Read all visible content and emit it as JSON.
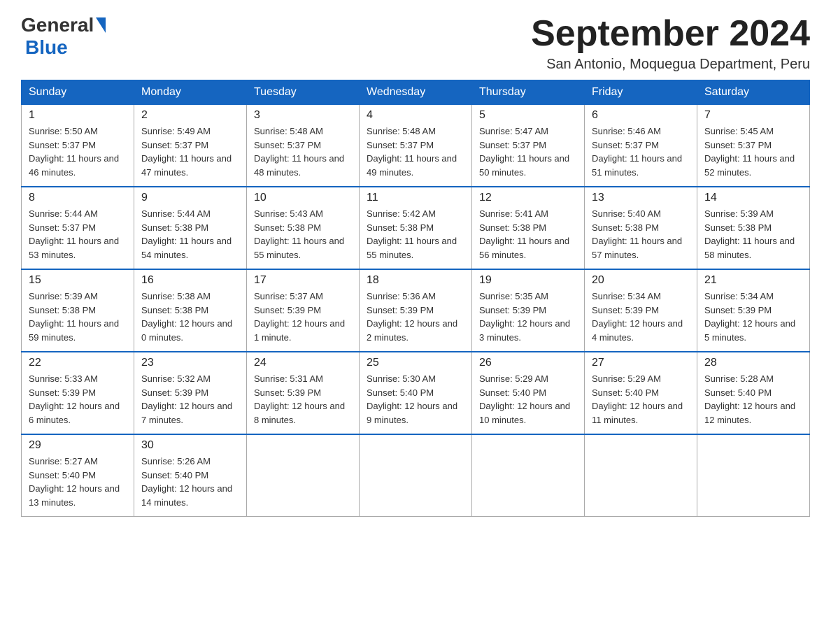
{
  "logo": {
    "general": "General",
    "blue": "Blue"
  },
  "header": {
    "month_year": "September 2024",
    "location": "San Antonio, Moquegua Department, Peru"
  },
  "weekdays": [
    "Sunday",
    "Monday",
    "Tuesday",
    "Wednesday",
    "Thursday",
    "Friday",
    "Saturday"
  ],
  "weeks": [
    [
      {
        "day": "1",
        "sunrise": "5:50 AM",
        "sunset": "5:37 PM",
        "daylight": "11 hours and 46 minutes."
      },
      {
        "day": "2",
        "sunrise": "5:49 AM",
        "sunset": "5:37 PM",
        "daylight": "11 hours and 47 minutes."
      },
      {
        "day": "3",
        "sunrise": "5:48 AM",
        "sunset": "5:37 PM",
        "daylight": "11 hours and 48 minutes."
      },
      {
        "day": "4",
        "sunrise": "5:48 AM",
        "sunset": "5:37 PM",
        "daylight": "11 hours and 49 minutes."
      },
      {
        "day": "5",
        "sunrise": "5:47 AM",
        "sunset": "5:37 PM",
        "daylight": "11 hours and 50 minutes."
      },
      {
        "day": "6",
        "sunrise": "5:46 AM",
        "sunset": "5:37 PM",
        "daylight": "11 hours and 51 minutes."
      },
      {
        "day": "7",
        "sunrise": "5:45 AM",
        "sunset": "5:37 PM",
        "daylight": "11 hours and 52 minutes."
      }
    ],
    [
      {
        "day": "8",
        "sunrise": "5:44 AM",
        "sunset": "5:37 PM",
        "daylight": "11 hours and 53 minutes."
      },
      {
        "day": "9",
        "sunrise": "5:44 AM",
        "sunset": "5:38 PM",
        "daylight": "11 hours and 54 minutes."
      },
      {
        "day": "10",
        "sunrise": "5:43 AM",
        "sunset": "5:38 PM",
        "daylight": "11 hours and 55 minutes."
      },
      {
        "day": "11",
        "sunrise": "5:42 AM",
        "sunset": "5:38 PM",
        "daylight": "11 hours and 55 minutes."
      },
      {
        "day": "12",
        "sunrise": "5:41 AM",
        "sunset": "5:38 PM",
        "daylight": "11 hours and 56 minutes."
      },
      {
        "day": "13",
        "sunrise": "5:40 AM",
        "sunset": "5:38 PM",
        "daylight": "11 hours and 57 minutes."
      },
      {
        "day": "14",
        "sunrise": "5:39 AM",
        "sunset": "5:38 PM",
        "daylight": "11 hours and 58 minutes."
      }
    ],
    [
      {
        "day": "15",
        "sunrise": "5:39 AM",
        "sunset": "5:38 PM",
        "daylight": "11 hours and 59 minutes."
      },
      {
        "day": "16",
        "sunrise": "5:38 AM",
        "sunset": "5:38 PM",
        "daylight": "12 hours and 0 minutes."
      },
      {
        "day": "17",
        "sunrise": "5:37 AM",
        "sunset": "5:39 PM",
        "daylight": "12 hours and 1 minute."
      },
      {
        "day": "18",
        "sunrise": "5:36 AM",
        "sunset": "5:39 PM",
        "daylight": "12 hours and 2 minutes."
      },
      {
        "day": "19",
        "sunrise": "5:35 AM",
        "sunset": "5:39 PM",
        "daylight": "12 hours and 3 minutes."
      },
      {
        "day": "20",
        "sunrise": "5:34 AM",
        "sunset": "5:39 PM",
        "daylight": "12 hours and 4 minutes."
      },
      {
        "day": "21",
        "sunrise": "5:34 AM",
        "sunset": "5:39 PM",
        "daylight": "12 hours and 5 minutes."
      }
    ],
    [
      {
        "day": "22",
        "sunrise": "5:33 AM",
        "sunset": "5:39 PM",
        "daylight": "12 hours and 6 minutes."
      },
      {
        "day": "23",
        "sunrise": "5:32 AM",
        "sunset": "5:39 PM",
        "daylight": "12 hours and 7 minutes."
      },
      {
        "day": "24",
        "sunrise": "5:31 AM",
        "sunset": "5:39 PM",
        "daylight": "12 hours and 8 minutes."
      },
      {
        "day": "25",
        "sunrise": "5:30 AM",
        "sunset": "5:40 PM",
        "daylight": "12 hours and 9 minutes."
      },
      {
        "day": "26",
        "sunrise": "5:29 AM",
        "sunset": "5:40 PM",
        "daylight": "12 hours and 10 minutes."
      },
      {
        "day": "27",
        "sunrise": "5:29 AM",
        "sunset": "5:40 PM",
        "daylight": "12 hours and 11 minutes."
      },
      {
        "day": "28",
        "sunrise": "5:28 AM",
        "sunset": "5:40 PM",
        "daylight": "12 hours and 12 minutes."
      }
    ],
    [
      {
        "day": "29",
        "sunrise": "5:27 AM",
        "sunset": "5:40 PM",
        "daylight": "12 hours and 13 minutes."
      },
      {
        "day": "30",
        "sunrise": "5:26 AM",
        "sunset": "5:40 PM",
        "daylight": "12 hours and 14 minutes."
      },
      null,
      null,
      null,
      null,
      null
    ]
  ],
  "labels": {
    "sunrise": "Sunrise:",
    "sunset": "Sunset:",
    "daylight": "Daylight:"
  }
}
